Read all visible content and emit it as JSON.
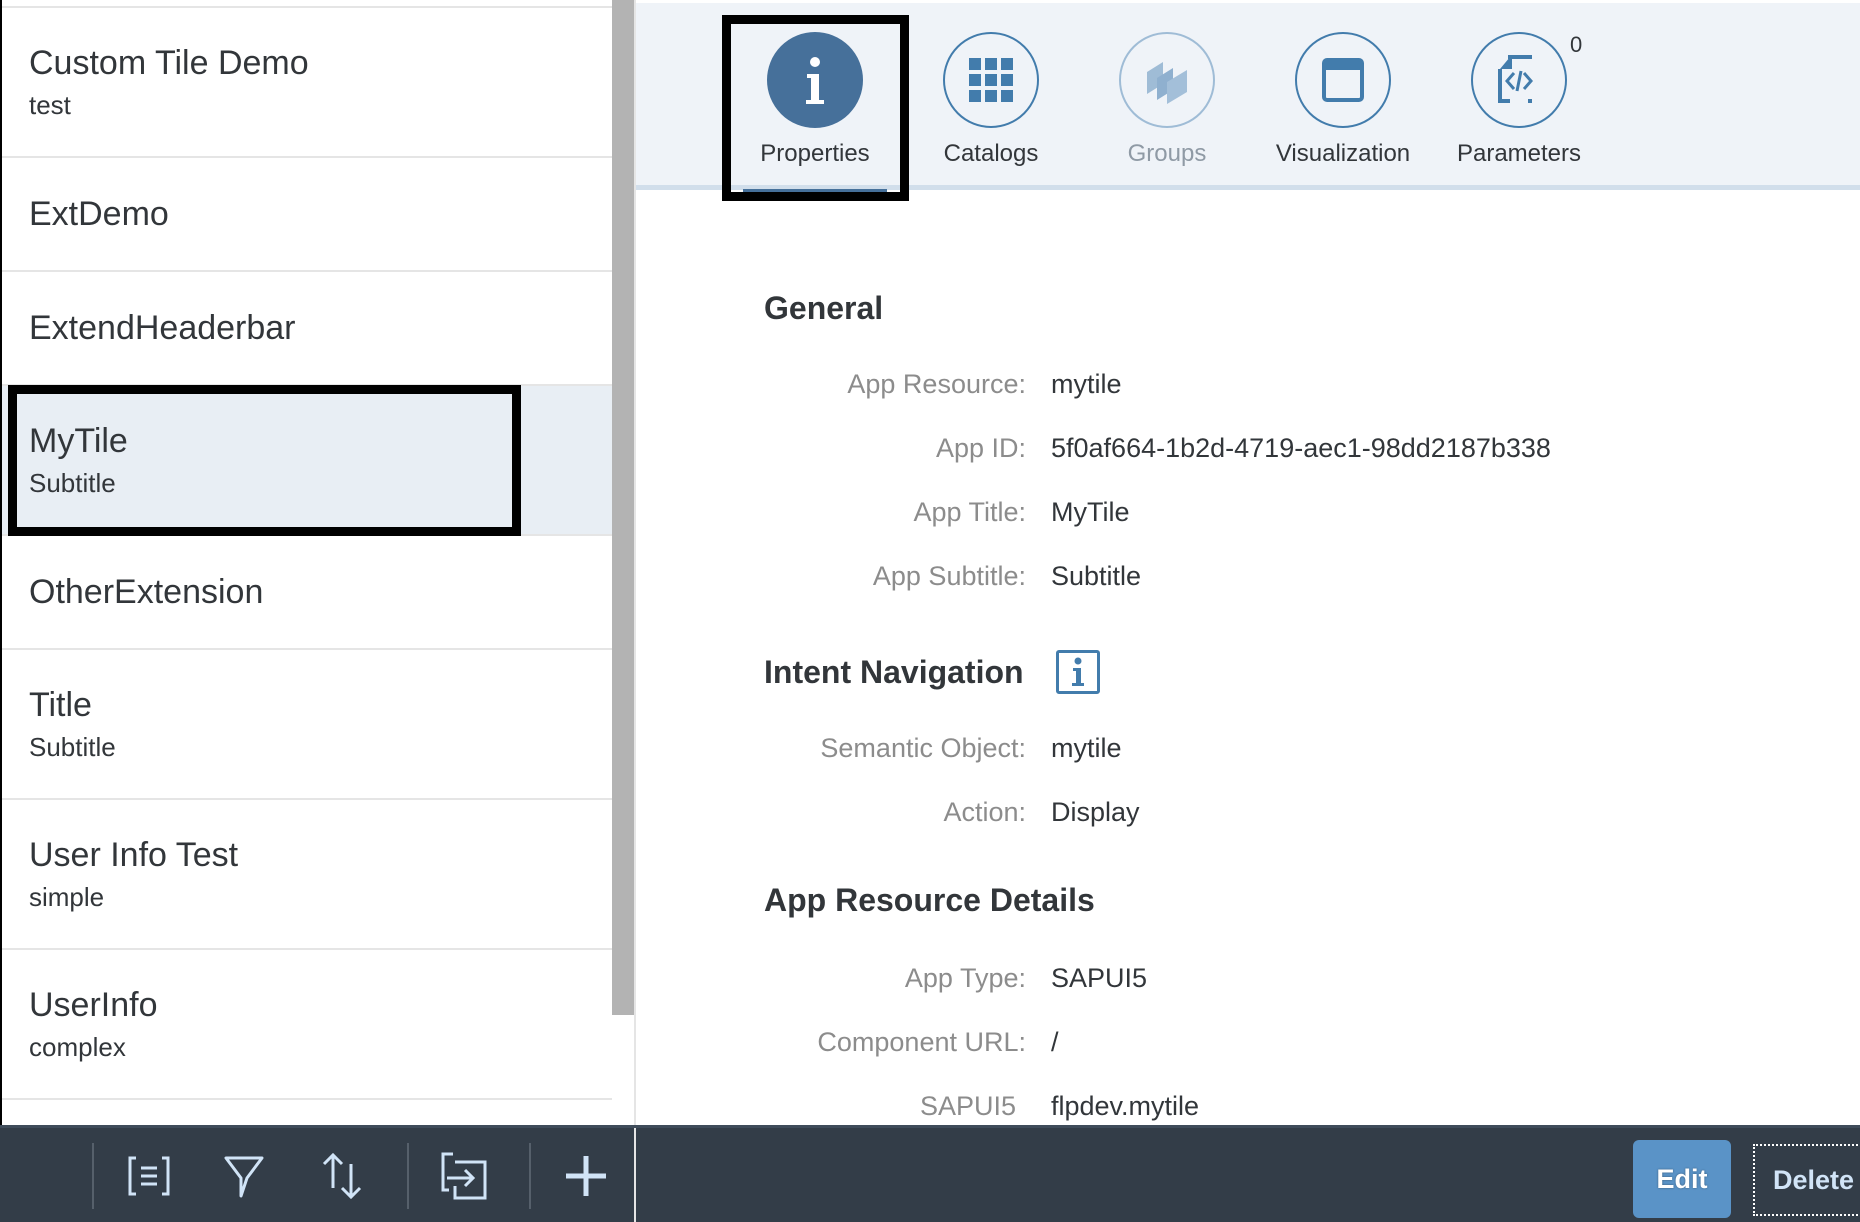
{
  "master_list": {
    "items": [
      {
        "title": "Custom Tile Demo",
        "description": "test",
        "selected": false
      },
      {
        "title": "ExtDemo",
        "description": "",
        "selected": false
      },
      {
        "title": "ExtendHeaderbar",
        "description": "",
        "selected": false
      },
      {
        "title": "MyTile",
        "description": "Subtitle",
        "selected": true
      },
      {
        "title": "OtherExtension",
        "description": "",
        "selected": false
      },
      {
        "title": "Title",
        "description": "Subtitle",
        "selected": false
      },
      {
        "title": "User Info Test",
        "description": "simple",
        "selected": false
      },
      {
        "title": "UserInfo",
        "description": "complex",
        "selected": false
      }
    ]
  },
  "tabs": [
    {
      "label": "Properties",
      "icon": "info-icon",
      "state": "active"
    },
    {
      "label": "Catalogs",
      "icon": "grid-icon",
      "state": "normal"
    },
    {
      "label": "Groups",
      "icon": "groups-icon",
      "state": "disabled"
    },
    {
      "label": "Visualization",
      "icon": "window-icon",
      "state": "normal"
    },
    {
      "label": "Parameters",
      "icon": "code-file-icon",
      "state": "normal",
      "badge": "0"
    }
  ],
  "sections": {
    "general": {
      "title": "General",
      "fields": [
        {
          "label": "App Resource:",
          "value": "mytile"
        },
        {
          "label": "App ID:",
          "value": "5f0af664-1b2d-4719-aec1-98dd2187b338"
        },
        {
          "label": "App Title:",
          "value": "MyTile"
        },
        {
          "label": "App Subtitle:",
          "value": "Subtitle"
        }
      ]
    },
    "intent_navigation": {
      "title": "Intent Navigation",
      "info_icon": "info-icon",
      "fields": [
        {
          "label": "Semantic Object:",
          "value": "mytile"
        },
        {
          "label": "Action:",
          "value": "Display"
        }
      ]
    },
    "app_resource_details": {
      "title": "App Resource Details",
      "fields": [
        {
          "label": "App Type:",
          "value": "SAPUI5"
        },
        {
          "label": "Component URL:",
          "value": "/"
        },
        {
          "label": "SAPUI5",
          "value": "flpdev.mytile"
        }
      ]
    }
  },
  "footer": {
    "master_actions": [
      {
        "name": "multi-select",
        "icon": "list-select-icon"
      },
      {
        "name": "filter",
        "icon": "filter-icon"
      },
      {
        "name": "sort",
        "icon": "sort-icon"
      },
      {
        "name": "import",
        "icon": "import-icon"
      },
      {
        "name": "add",
        "icon": "plus-icon"
      }
    ],
    "edit_label": "Edit",
    "delete_label": "Delete"
  },
  "colors": {
    "accent": "#46709a",
    "footer_bg": "#333d48",
    "edit_button": "#5a93c7",
    "selected_row": "#e8eef4",
    "tabbar_bg": "#eff3f8"
  }
}
